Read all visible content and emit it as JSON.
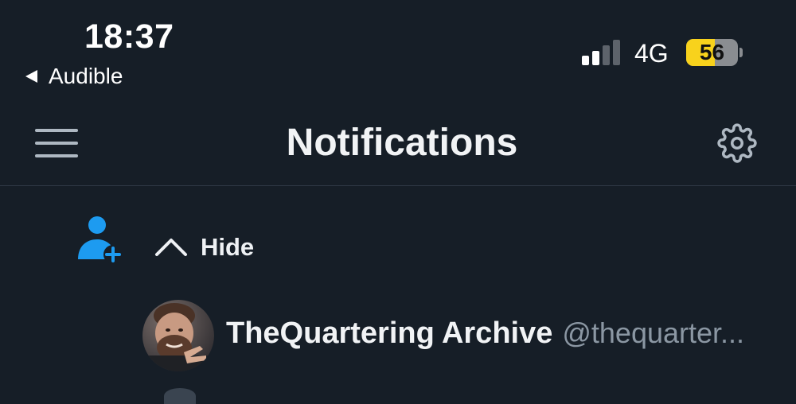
{
  "status_bar": {
    "time": "18:37",
    "back_app": "Audible",
    "network": "4G",
    "battery_percent": "56",
    "battery_level": 0.56,
    "signal_bars_active": 2,
    "signal_bars_total": 4,
    "battery_color": "#f8d21c"
  },
  "header": {
    "title": "Notifications",
    "menu_icon": "hamburger-menu-icon",
    "settings_icon": "gear-icon"
  },
  "notification": {
    "type_icon": "follow-user-plus-icon",
    "toggle_icon": "chevron-up-icon",
    "toggle_label": "Hide",
    "accent_color": "#1d9bf0",
    "user": {
      "name": "TheQuartering Archive",
      "handle": "@thequarter..."
    }
  },
  "colors": {
    "background": "#161e27",
    "divider": "#2f3945",
    "secondary_text": "#8b97a3"
  }
}
